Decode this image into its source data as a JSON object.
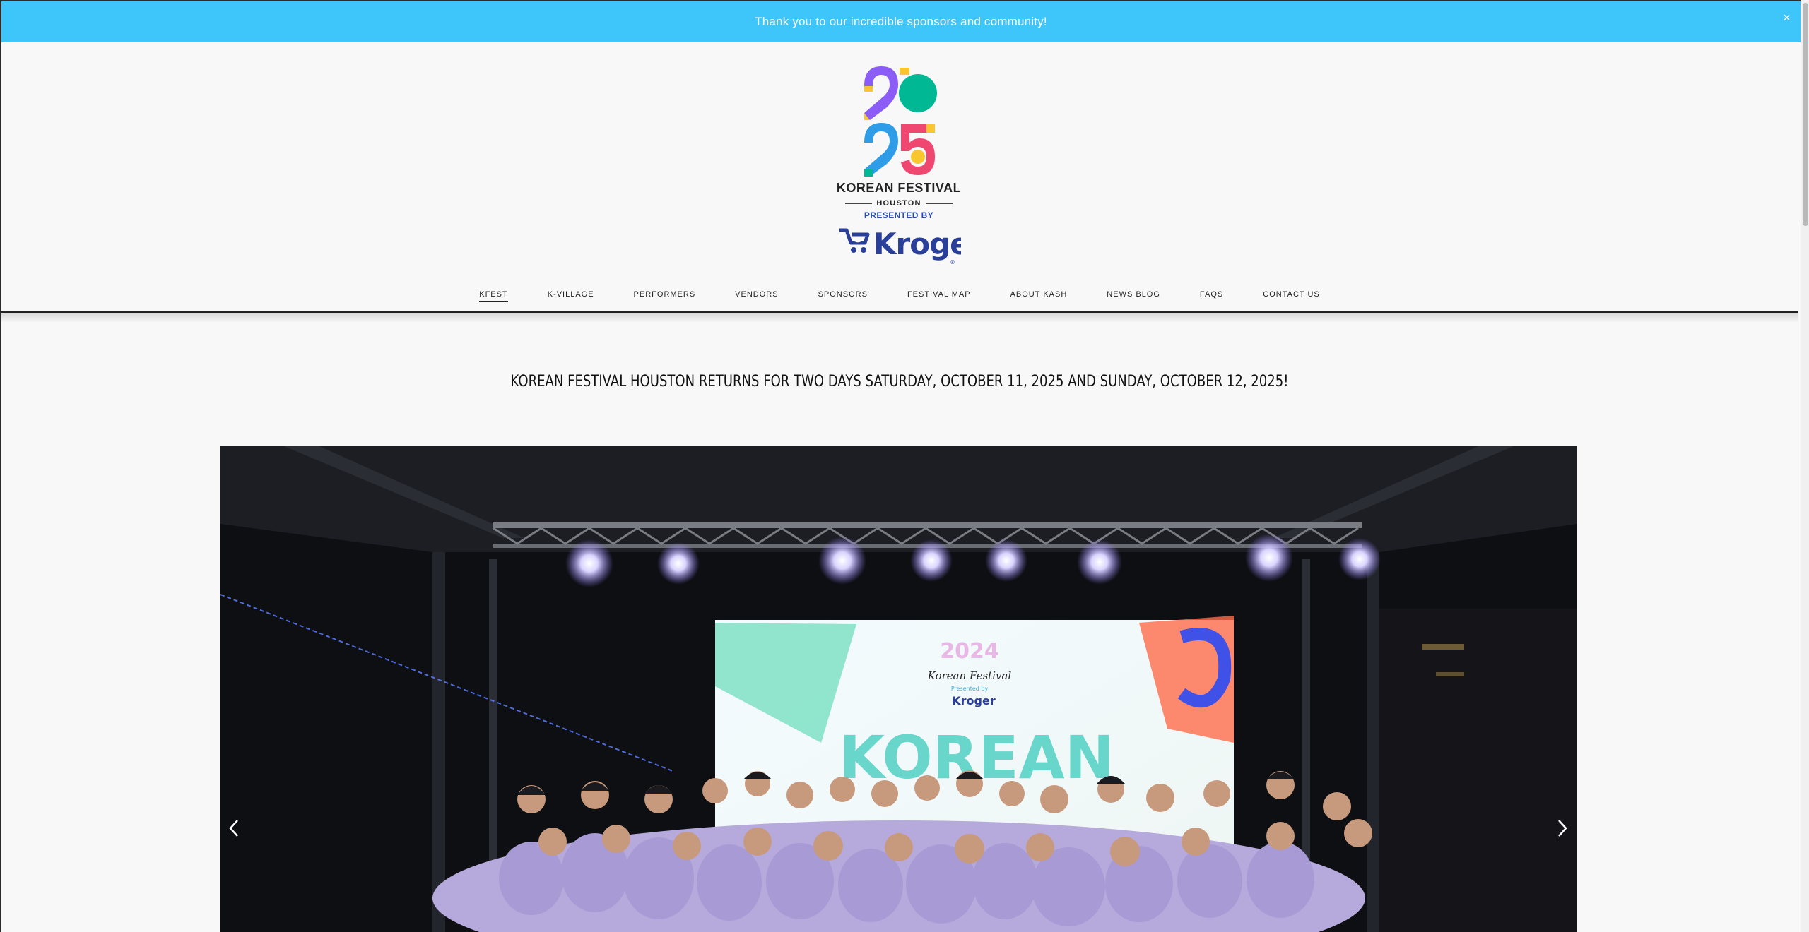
{
  "announcement": {
    "text": "Thank you to our incredible sponsors and community!",
    "close_label": "×",
    "background": "#3ec6fa"
  },
  "logo": {
    "year_top": "20",
    "year_bottom": "25",
    "title": "KOREAN FESTIVAL",
    "city": "HOUSTON",
    "presented_by": "PRESENTED BY",
    "sponsor": "Kroger",
    "brand_colors": [
      "#8b5cf6",
      "#f9c630",
      "#00b894",
      "#2e9ce6",
      "#ef476f"
    ]
  },
  "nav": {
    "items": [
      {
        "label": "KFEST",
        "active": true
      },
      {
        "label": "K-VILLAGE"
      },
      {
        "label": "PERFORMERS"
      },
      {
        "label": "VENDORS"
      },
      {
        "label": "SPONSORS"
      },
      {
        "label": "FESTIVAL MAP"
      },
      {
        "label": "ABOUT KASH"
      },
      {
        "label": "NEWS BLOG"
      },
      {
        "label": "FAQS"
      },
      {
        "label": "CONTACT US"
      }
    ]
  },
  "headline": "KOREAN FESTIVAL HOUSTON RETURNS FOR TWO DAYS SATURDAY, OCTOBER 11, 2025 AND SUNDAY, OCTOBER 12, 2025!",
  "slideshow": {
    "screen_year": "2024",
    "screen_title": "Korean Festival",
    "screen_presented": "Presented by",
    "screen_sponsor": "Kroger",
    "screen_big_text": "KOREAN",
    "prev_icon": "chevron-left-icon",
    "next_icon": "chevron-right-icon"
  }
}
